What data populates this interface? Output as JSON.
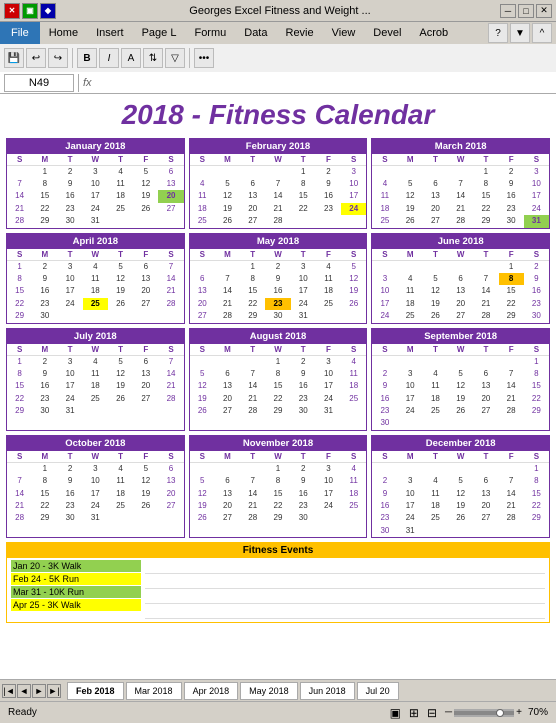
{
  "titleBar": {
    "title": "Georges Excel Fitness and Weight ...",
    "icons": [
      "X",
      "G",
      "B"
    ]
  },
  "ribbon": {
    "tabs": [
      "File",
      "Home",
      "Insert",
      "Page L",
      "Formu",
      "Data",
      "Revie",
      "View",
      "Devel",
      "Acrob"
    ],
    "activeTab": "File",
    "cellRef": "N49"
  },
  "pageTitle": "2018 - Fitness Calendar",
  "months": [
    {
      "name": "January 2018",
      "days": [
        "",
        "1",
        "2",
        "3",
        "4",
        "5",
        "6",
        "7",
        "8",
        "9",
        "10",
        "11",
        "12",
        "13",
        "14",
        "15",
        "16",
        "17",
        "18",
        "19",
        "20",
        "21",
        "22",
        "23",
        "24",
        "25",
        "26",
        "27",
        "28",
        "29",
        "30",
        "31",
        ""
      ],
      "highlights": {
        "20": "green"
      }
    },
    {
      "name": "February 2018",
      "days": [
        "",
        "",
        "",
        "1",
        "2",
        "3",
        "4",
        "5",
        "6",
        "7",
        "8",
        "9",
        "10",
        "11",
        "12",
        "13",
        "14",
        "15",
        "16",
        "17",
        "18",
        "19",
        "20",
        "21",
        "22",
        "23",
        "24",
        "25",
        "26",
        "27",
        "28",
        ""
      ],
      "highlights": {
        "24": "yellow"
      }
    },
    {
      "name": "March 2018",
      "days": [
        "",
        "",
        "",
        "1",
        "2",
        "3",
        "4",
        "5",
        "6",
        "7",
        "8",
        "9",
        "10",
        "11",
        "12",
        "13",
        "14",
        "15",
        "16",
        "17",
        "18",
        "19",
        "20",
        "21",
        "22",
        "23",
        "24",
        "25",
        "26",
        "27",
        "28",
        "29",
        "30",
        "31"
      ],
      "highlights": {
        "31": "green"
      }
    },
    {
      "name": "April 2018",
      "days": [
        "1",
        "2",
        "3",
        "4",
        "5",
        "6",
        "7",
        "8",
        "9",
        "10",
        "11",
        "12",
        "13",
        "14",
        "15",
        "16",
        "17",
        "18",
        "19",
        "20",
        "21",
        "22",
        "23",
        "24",
        "25",
        "26",
        "27",
        "28",
        "29",
        "30",
        "",
        "",
        ""
      ],
      "highlights": {
        "25": "yellow"
      }
    },
    {
      "name": "May 2018",
      "days": [
        "",
        "",
        "1",
        "2",
        "3",
        "4",
        "5",
        "6",
        "7",
        "8",
        "9",
        "10",
        "11",
        "12",
        "13",
        "14",
        "15",
        "16",
        "17",
        "18",
        "19",
        "20",
        "21",
        "22",
        "23",
        "24",
        "25",
        "26",
        "27",
        "28",
        "29",
        "30",
        "31"
      ],
      "highlights": {
        "23": "orange"
      }
    },
    {
      "name": "June 2018",
      "days": [
        "",
        "",
        "",
        "",
        "",
        "1",
        "2",
        "3",
        "4",
        "5",
        "6",
        "7",
        "8",
        "9",
        "10",
        "11",
        "12",
        "13",
        "14",
        "15",
        "16",
        "17",
        "18",
        "19",
        "20",
        "21",
        "22",
        "23",
        "24",
        "25",
        "26",
        "27",
        "28",
        "29",
        "30"
      ],
      "highlights": {
        "8": "orange"
      }
    },
    {
      "name": "July 2018",
      "days": [
        "1",
        "2",
        "3",
        "4",
        "5",
        "6",
        "7",
        "8",
        "9",
        "10",
        "11",
        "12",
        "13",
        "14",
        "15",
        "16",
        "17",
        "18",
        "19",
        "20",
        "21",
        "22",
        "23",
        "24",
        "25",
        "26",
        "27",
        "28",
        "29",
        "30",
        "31",
        "",
        ""
      ],
      "highlights": {}
    },
    {
      "name": "August 2018",
      "days": [
        "",
        "",
        "",
        "1",
        "2",
        "3",
        "4",
        "5",
        "6",
        "7",
        "8",
        "9",
        "10",
        "11",
        "12",
        "13",
        "14",
        "15",
        "16",
        "17",
        "18",
        "19",
        "20",
        "21",
        "22",
        "23",
        "24",
        "25",
        "26",
        "27",
        "28",
        "29",
        "30",
        "31"
      ],
      "highlights": {}
    },
    {
      "name": "September 2018",
      "days": [
        "",
        "",
        "",
        "",
        "",
        "",
        "1",
        "2",
        "3",
        "4",
        "5",
        "6",
        "7",
        "8",
        "9",
        "10",
        "11",
        "12",
        "13",
        "14",
        "15",
        "16",
        "17",
        "18",
        "19",
        "20",
        "21",
        "22",
        "23",
        "24",
        "25",
        "26",
        "27",
        "28",
        "29",
        "30",
        ""
      ],
      "highlights": {}
    },
    {
      "name": "October 2018",
      "days": [
        "",
        "1",
        "2",
        "3",
        "4",
        "5",
        "6",
        "7",
        "8",
        "9",
        "10",
        "11",
        "12",
        "13",
        "14",
        "15",
        "16",
        "17",
        "18",
        "19",
        "20",
        "21",
        "22",
        "23",
        "24",
        "25",
        "26",
        "27",
        "28",
        "29",
        "30",
        "31",
        ""
      ],
      "highlights": {}
    },
    {
      "name": "November 2018",
      "days": [
        "",
        "",
        "",
        "1",
        "2",
        "3",
        "4",
        "5",
        "6",
        "7",
        "8",
        "9",
        "10",
        "11",
        "12",
        "13",
        "14",
        "15",
        "16",
        "17",
        "18",
        "19",
        "20",
        "21",
        "22",
        "23",
        "24",
        "25",
        "26",
        "27",
        "28",
        "29",
        "30",
        ""
      ],
      "highlights": {}
    },
    {
      "name": "December 2018",
      "days": [
        "",
        "",
        "",
        "",
        "",
        "",
        "1",
        "2",
        "3",
        "4",
        "5",
        "6",
        "7",
        "8",
        "9",
        "10",
        "11",
        "12",
        "13",
        "14",
        "15",
        "16",
        "17",
        "18",
        "19",
        "20",
        "21",
        "22",
        "23",
        "24",
        "25",
        "26",
        "27",
        "28",
        "29",
        "30",
        "31"
      ],
      "highlights": {}
    }
  ],
  "fitnessEvents": {
    "title": "Fitness Events",
    "events": [
      {
        "label": "Jan 20 - 3K Walk",
        "class": "event-green"
      },
      {
        "label": "Feb 24 - 5K Run",
        "class": "event-yellow"
      },
      {
        "label": "Mar 31 - 10K Run",
        "class": "event-green"
      },
      {
        "label": "Apr 25 - 3K Walk",
        "class": "event-yellow"
      }
    ]
  },
  "sheetTabs": [
    "Feb 2018",
    "Mar 2018",
    "Apr 2018",
    "May 2018",
    "Jun 2018",
    "Jul 20"
  ],
  "statusBar": {
    "ready": "Ready",
    "zoom": "70%"
  }
}
